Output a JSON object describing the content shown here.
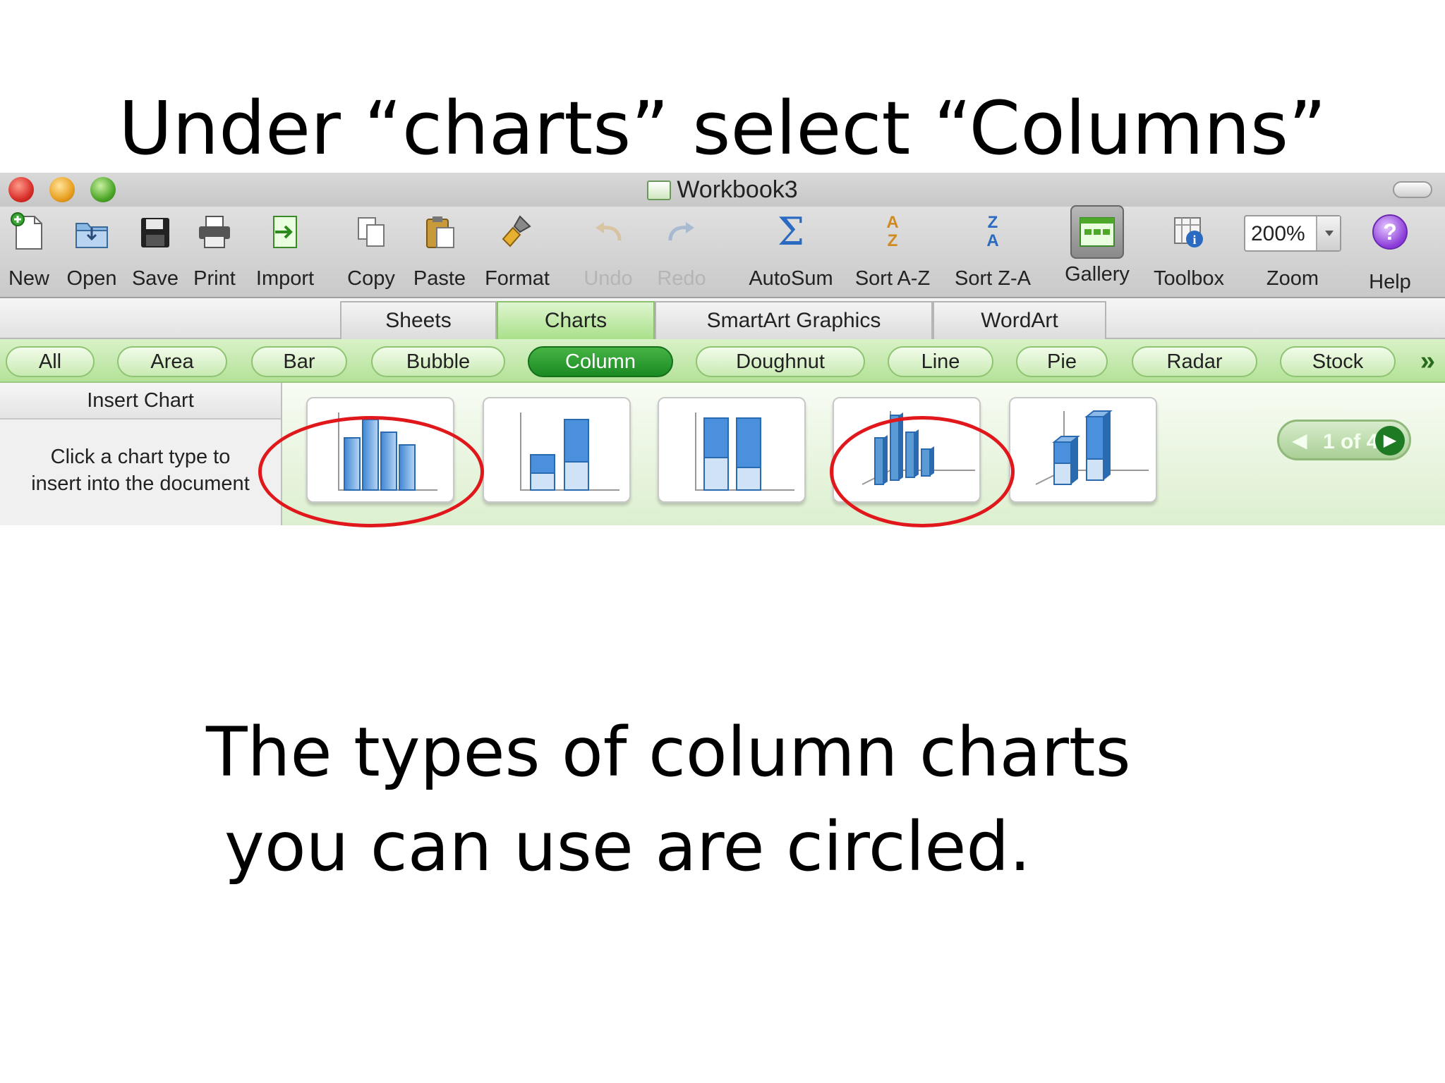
{
  "slide": {
    "title": "Under “charts” select “Columns”",
    "caption_line1": "The types of column charts",
    "caption_line2": "you can use are circled."
  },
  "window": {
    "title": "Workbook3"
  },
  "toolbar": {
    "items": [
      {
        "label": "New",
        "icon": "new-document-icon"
      },
      {
        "label": "Open",
        "icon": "open-folder-icon"
      },
      {
        "label": "Save",
        "icon": "floppy-disk-icon"
      },
      {
        "label": "Print",
        "icon": "printer-icon"
      },
      {
        "label": "Import",
        "icon": "import-icon"
      },
      {
        "label": "Copy",
        "icon": "copy-icon"
      },
      {
        "label": "Paste",
        "icon": "clipboard-icon"
      },
      {
        "label": "Format",
        "icon": "paintbrush-icon"
      },
      {
        "label": "Undo",
        "icon": "undo-icon"
      },
      {
        "label": "Redo",
        "icon": "redo-icon"
      },
      {
        "label": "AutoSum",
        "icon": "sigma-icon"
      },
      {
        "label": "Sort A-Z",
        "icon": "sort-ascending-icon"
      },
      {
        "label": "Sort Z-A",
        "icon": "sort-descending-icon"
      },
      {
        "label": "Gallery",
        "icon": "gallery-icon"
      },
      {
        "label": "Toolbox",
        "icon": "toolbox-icon"
      },
      {
        "label": "Zoom",
        "icon": "zoom-select"
      },
      {
        "label": "Help",
        "icon": "help-icon"
      }
    ],
    "zoom_value": "200%",
    "sigma_glyph": "Σ",
    "help_glyph": "?",
    "sort_az_glyph": "A\nZ",
    "sort_za_glyph": "Z\nA"
  },
  "tabs": [
    "Sheets",
    "Charts",
    "SmartArt Graphics",
    "WordArt"
  ],
  "chart_filters": [
    "All",
    "Area",
    "Bar",
    "Bubble",
    "Column",
    "Doughnut",
    "Line",
    "Pie",
    "Radar",
    "Stock"
  ],
  "insert_chart": {
    "header": "Insert Chart",
    "hint_line1": "Click a chart type to",
    "hint_line2": "insert into the document"
  },
  "gallery": {
    "thumbnails": [
      "clustered-column-icon",
      "stacked-column-icon",
      "100-stacked-column-icon",
      "3d-clustered-column-icon",
      "3d-stacked-column-icon"
    ],
    "pager_label": "1 of 4",
    "prev_glyph": "◀",
    "next_glyph": "▶",
    "more_glyph": "»"
  },
  "colors": {
    "accent_green": "#1a8a23",
    "highlight_red": "#e0181c",
    "bar_blue": "#5b9bd5"
  }
}
